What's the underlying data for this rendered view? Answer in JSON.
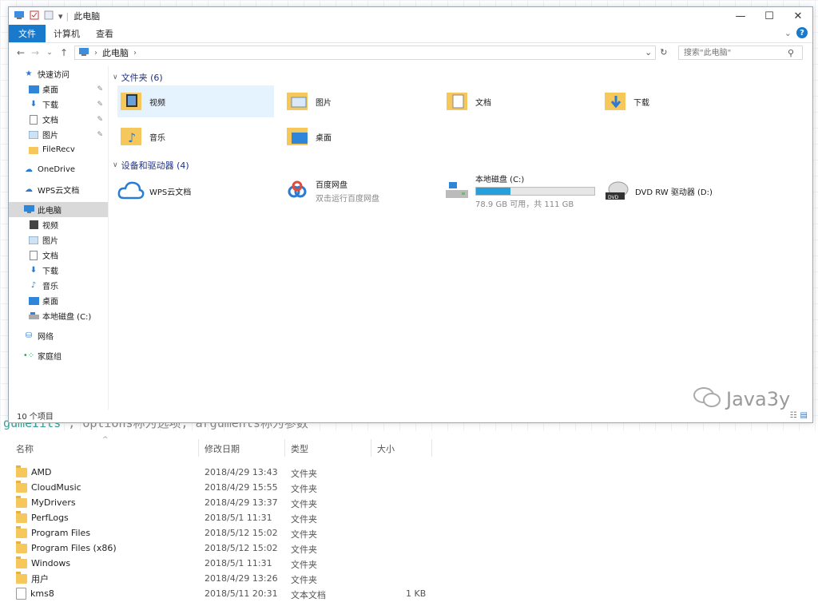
{
  "background": {
    "caption_prefix": "gumeIits",
    "caption_rest": " , options称为选项, arguments称为参数"
  },
  "window": {
    "title": "此电脑",
    "controls": {
      "minimize": "—",
      "maximize": "☐",
      "close": "✕"
    },
    "ribbon_tabs": [
      "文件",
      "计算机",
      "查看"
    ],
    "address": {
      "location": "此电脑",
      "search_placeholder": "搜索\"此电脑\""
    },
    "nav": [
      {
        "label": "快速访问",
        "icon": "star-icon",
        "pinned": false
      },
      {
        "label": "桌面",
        "icon": "desktop-icon",
        "pinned": true
      },
      {
        "label": "下载",
        "icon": "download-icon",
        "pinned": true
      },
      {
        "label": "文档",
        "icon": "document-icon",
        "pinned": true
      },
      {
        "label": "图片",
        "icon": "picture-icon",
        "pinned": true
      },
      {
        "label": "FileRecv",
        "icon": "folder-icon",
        "pinned": false
      },
      {
        "label": "OneDrive",
        "icon": "onedrive-icon",
        "pinned": false
      },
      {
        "label": "WPS云文档",
        "icon": "cloud-icon",
        "pinned": false
      },
      {
        "label": "此电脑",
        "icon": "computer-icon",
        "pinned": false
      },
      {
        "label": "视频",
        "icon": "video-icon",
        "pinned": false
      },
      {
        "label": "图片",
        "icon": "picture-icon",
        "pinned": false
      },
      {
        "label": "文档",
        "icon": "document-icon",
        "pinned": false
      },
      {
        "label": "下载",
        "icon": "download-icon",
        "pinned": false
      },
      {
        "label": "音乐",
        "icon": "music-icon",
        "pinned": false
      },
      {
        "label": "桌面",
        "icon": "desktop-icon",
        "pinned": false
      },
      {
        "label": "本地磁盘 (C:)",
        "icon": "drive-icon",
        "pinned": false
      },
      {
        "label": "网络",
        "icon": "network-icon",
        "pinned": false
      },
      {
        "label": "家庭组",
        "icon": "homegroup-icon",
        "pinned": false
      }
    ],
    "folders_group": "文件夹 (6)",
    "folders": [
      "视频",
      "图片",
      "文档",
      "下载",
      "音乐",
      "桌面"
    ],
    "devices_group": "设备和驱动器 (4)",
    "devices": [
      {
        "name": "WPS云文档",
        "sub": ""
      },
      {
        "name": "百度网盘",
        "sub": "双击运行百度网盘"
      },
      {
        "name": "本地磁盘 (C:)",
        "sub": "78.9 GB 可用，共 111 GB",
        "used_fraction": 0.29
      },
      {
        "name": "DVD RW 驱动器 (D:)",
        "sub": ""
      }
    ],
    "status": "10 个项目",
    "watermark": "Java3y"
  },
  "file_list": {
    "headers": {
      "name": "名称",
      "modified": "修改日期",
      "type": "类型",
      "size": "大小"
    },
    "rows": [
      {
        "name": "AMD",
        "modified": "2018/4/29 13:43",
        "type": "文件夹",
        "size": "",
        "kind": "folder"
      },
      {
        "name": "CloudMusic",
        "modified": "2018/4/29 15:55",
        "type": "文件夹",
        "size": "",
        "kind": "folder"
      },
      {
        "name": "MyDrivers",
        "modified": "2018/4/29 13:37",
        "type": "文件夹",
        "size": "",
        "kind": "folder"
      },
      {
        "name": "PerfLogs",
        "modified": "2018/5/1 11:31",
        "type": "文件夹",
        "size": "",
        "kind": "folder"
      },
      {
        "name": "Program Files",
        "modified": "2018/5/12 15:02",
        "type": "文件夹",
        "size": "",
        "kind": "folder"
      },
      {
        "name": "Program Files (x86)",
        "modified": "2018/5/12 15:02",
        "type": "文件夹",
        "size": "",
        "kind": "folder"
      },
      {
        "name": "Windows",
        "modified": "2018/5/1 11:31",
        "type": "文件夹",
        "size": "",
        "kind": "folder"
      },
      {
        "name": "用户",
        "modified": "2018/4/29 13:26",
        "type": "文件夹",
        "size": "",
        "kind": "folder"
      },
      {
        "name": "kms8",
        "modified": "2018/5/11 20:31",
        "type": "文本文档",
        "size": "1 KB",
        "kind": "text"
      }
    ]
  },
  "colors": {
    "accent": "#1979ca",
    "folder": "#f6c75a",
    "drive_fill": "#26a0da",
    "group_title": "#1e3287"
  }
}
